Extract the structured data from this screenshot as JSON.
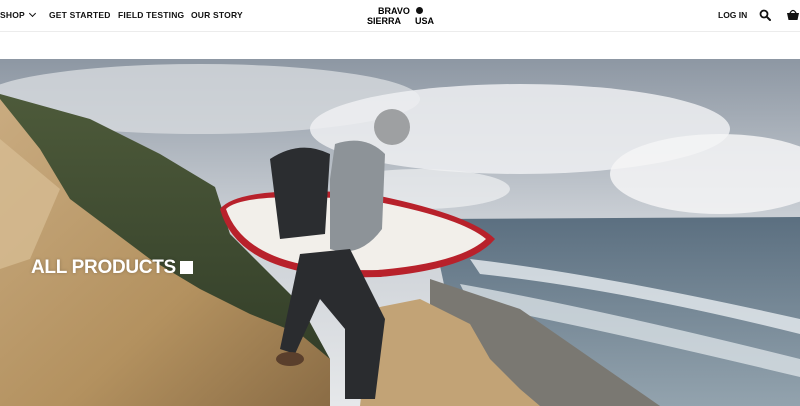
{
  "nav": {
    "shop_label": "SHOP",
    "get_started_label": "GET STARTED",
    "field_testing_label": "FIELD TESTING",
    "our_story_label": "OUR STORY",
    "login_label": "LOG IN",
    "icons": [
      "chevron-down-icon",
      "search-icon",
      "cart-icon"
    ]
  },
  "logo": {
    "line1": "BRAVO",
    "line2": "SIERRA",
    "line3": "USA"
  },
  "hero": {
    "title": "ALL PRODUCTS"
  },
  "colors": {
    "text": "#111111",
    "background": "#ffffff",
    "hero_text": "#ffffff"
  }
}
